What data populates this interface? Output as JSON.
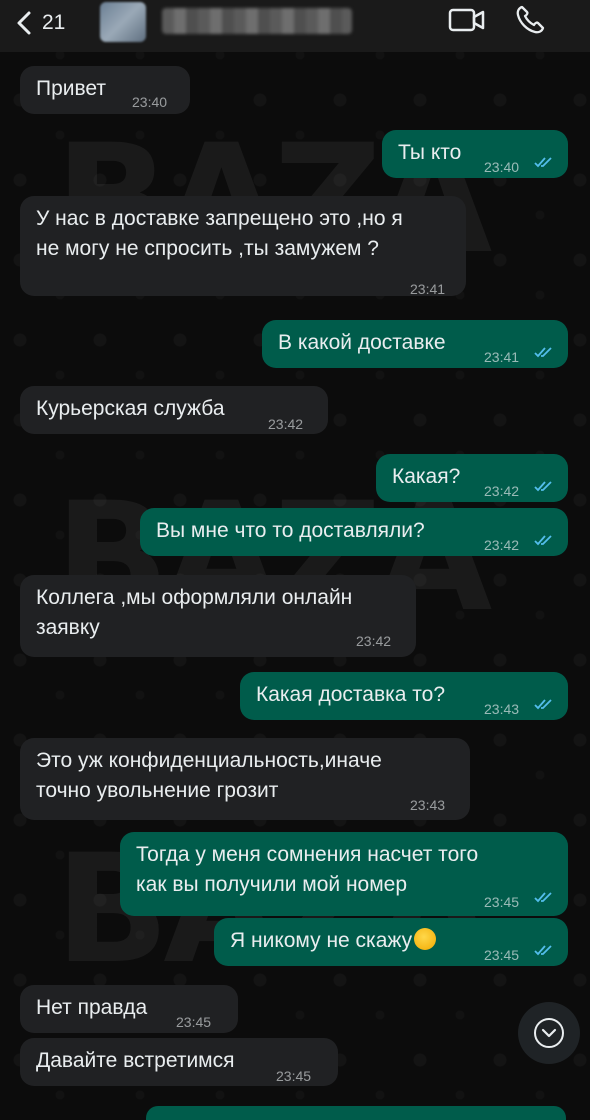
{
  "header": {
    "back_count": "21",
    "contact_name": "",
    "icons": {
      "back": "chevron-left-icon",
      "video": "video-call-icon",
      "phone": "phone-call-icon"
    }
  },
  "watermark": "BAZA",
  "messages": [
    {
      "dir": "in",
      "text": "Привет",
      "time": "23:40"
    },
    {
      "dir": "out",
      "text": "Ты кто",
      "time": "23:40",
      "read": true
    },
    {
      "dir": "in",
      "text": "У нас в доставке запрещено это ,но я\nне могу не спросить ,ты замужем ?",
      "time": "23:41"
    },
    {
      "dir": "out",
      "text": "В какой доставке",
      "time": "23:41",
      "read": true
    },
    {
      "dir": "in",
      "text": "Курьерская служба",
      "time": "23:42"
    },
    {
      "dir": "out",
      "text": "Какая?",
      "time": "23:42",
      "read": true
    },
    {
      "dir": "out",
      "text": "Вы мне что то доставляли?",
      "time": "23:42",
      "read": true
    },
    {
      "dir": "in",
      "text": "Коллега ,мы оформляли онлайн\nзаявку",
      "time": "23:42"
    },
    {
      "dir": "out",
      "text": "Какая доставка то?",
      "time": "23:43",
      "read": true
    },
    {
      "dir": "in",
      "text": "Это уж конфиденциальность,иначе\nточно увольнение грозит",
      "time": "23:43"
    },
    {
      "dir": "out",
      "text": "Тогда у меня сомнения насчет того\nкак вы получили мой номер",
      "time": "23:45",
      "read": true
    },
    {
      "dir": "out",
      "text": "Я никому не скажу",
      "emoji": "rolling-on-floor-laughing-emoji",
      "time": "23:45",
      "read": true
    },
    {
      "dir": "in",
      "text": "Нет правда",
      "time": "23:45"
    },
    {
      "dir": "in",
      "text": "Давайте встретимся",
      "time": "23:45"
    }
  ],
  "scroll_button_icon": "chevron-down-icon",
  "colors": {
    "incoming": "#202123",
    "outgoing": "#005c4b",
    "read_ticks": "#53bdeb",
    "header": "#1a1a1a"
  }
}
